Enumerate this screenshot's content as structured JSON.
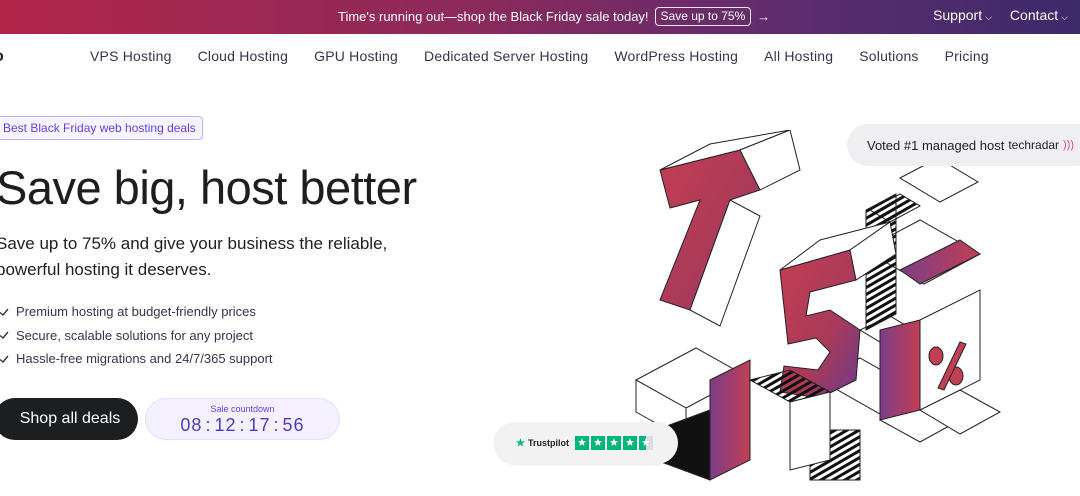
{
  "promo": {
    "message": "Time's running out—shop the Black Friday sale today!",
    "badge": "Save up to 75%",
    "arrow_icon": "arrow-right-icon",
    "support_label": "Support",
    "contact_label": "Contact"
  },
  "nav": {
    "logo": "o",
    "items": [
      {
        "label": "VPS Hosting"
      },
      {
        "label": "Cloud Hosting"
      },
      {
        "label": "GPU Hosting"
      },
      {
        "label": "Dedicated Server Hosting"
      },
      {
        "label": "WordPress Hosting"
      },
      {
        "label": "All Hosting"
      },
      {
        "label": "Solutions"
      },
      {
        "label": "Pricing"
      }
    ]
  },
  "hero": {
    "tag": "Best Black Friday web hosting deals",
    "headline": "Save big, host better",
    "subtitle": "Save up to 75% and give your business the reliable, powerful hosting it deserves.",
    "features": [
      "Premium hosting at budget-friendly prices",
      "Secure, scalable solutions for any project",
      "Hassle-free migrations and 24/7/365 support"
    ],
    "cta_label": "Shop all deals",
    "countdown": {
      "label": "Sale countdown",
      "days": "08",
      "hours": "12",
      "minutes": "17",
      "seconds": "56",
      "separator": ":"
    }
  },
  "badges": {
    "techradar_text": "Voted #1 managed host",
    "techradar_brand": "techradar",
    "trustpilot_label": "Trustpilot",
    "trustpilot_rating_stars": 4.5
  },
  "illustration": {
    "text": "75%"
  },
  "colors": {
    "accent": "#673de6",
    "promo_start": "#b2254a",
    "promo_end": "#3c2a6a",
    "cube_red": "#b8394f",
    "cube_purple": "#6b3b8a",
    "trustpilot_green": "#00b67a"
  }
}
